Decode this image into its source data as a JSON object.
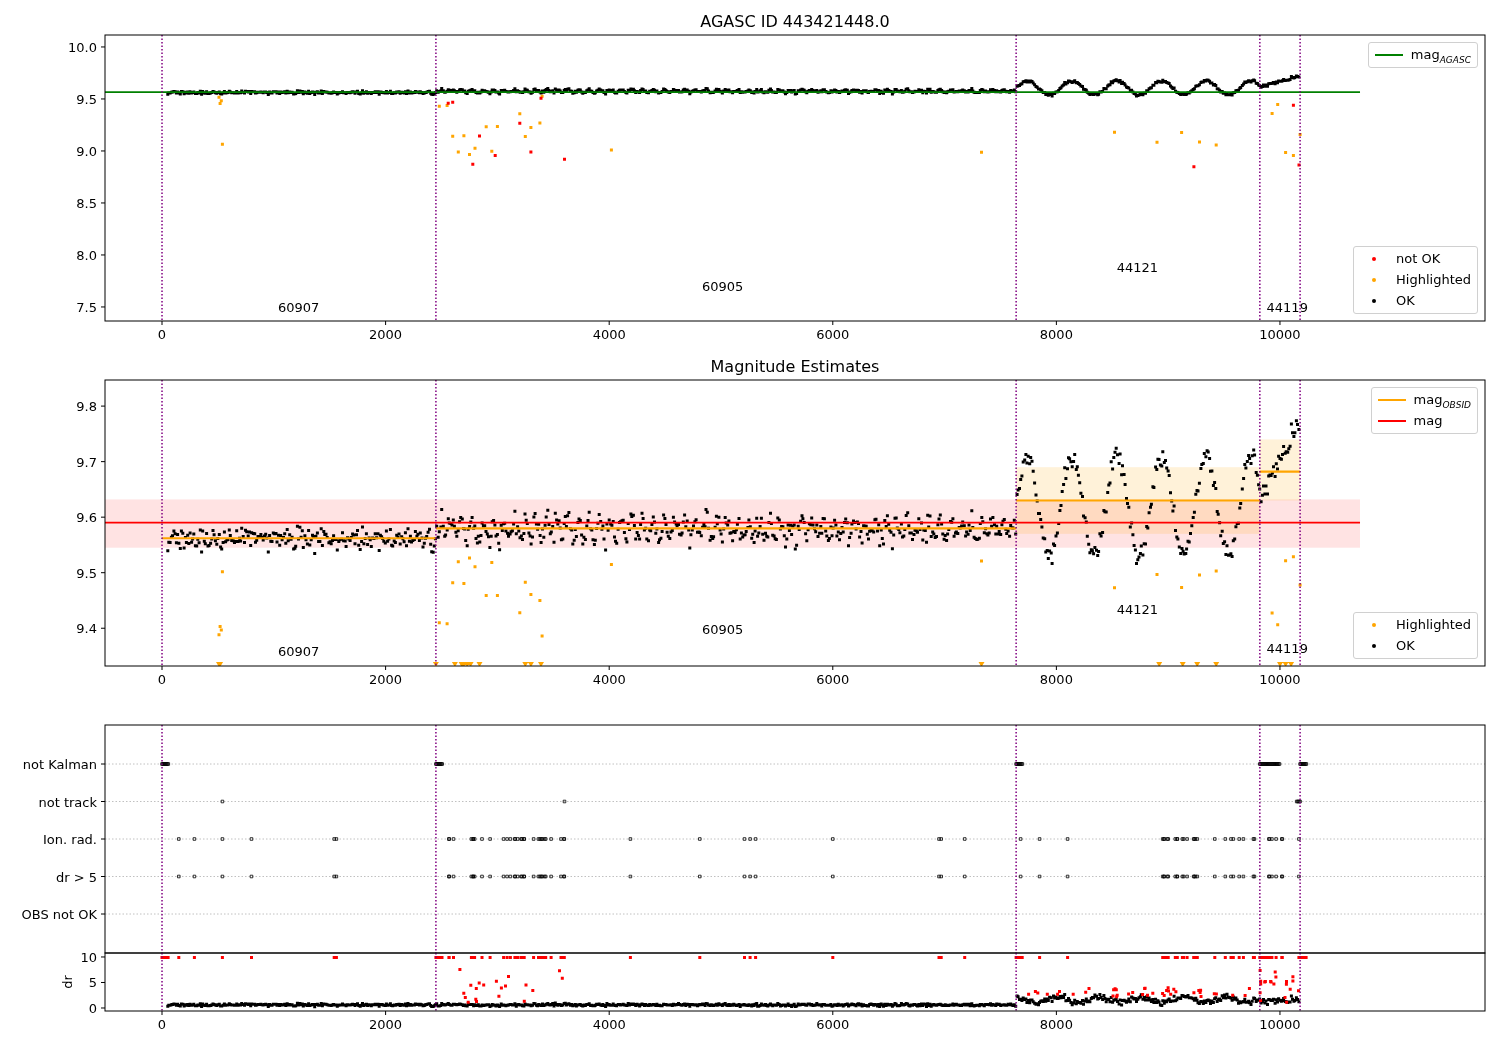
{
  "panels": [
    {
      "kind": "agasc",
      "title": "AGASC ID 443421448.0",
      "y_tick_labels": [
        "10.0",
        "9.5",
        "9.0",
        "8.5",
        "8.0",
        "7.5"
      ],
      "x_tick_labels": [
        "0",
        "2000",
        "4000",
        "6000",
        "8000",
        "10000"
      ],
      "obsid_labels": [
        "60907",
        "60905",
        "44121",
        "44119"
      ],
      "legends": [
        [
          {
            "label": "mag$_{AGASC}$",
            "color": "#008000"
          }
        ],
        [
          {
            "label": "not OK",
            "color": "#ff0000"
          },
          {
            "label": "Highlighted",
            "color": "#ffa500"
          },
          {
            "label": "OK",
            "color": "#000000"
          }
        ]
      ]
    },
    {
      "kind": "estimates",
      "title": "Magnitude Estimates",
      "y_tick_labels": [
        "9.8",
        "9.7",
        "9.6",
        "9.5",
        "9.4"
      ],
      "x_tick_labels": [
        "0",
        "2000",
        "4000",
        "6000",
        "8000",
        "10000"
      ],
      "obsid_labels": [
        "60907",
        "60905",
        "44121",
        "44119"
      ],
      "legends": [
        [
          {
            "label": "mag$_{OBSID}$",
            "color": "#ffa500"
          },
          {
            "label": "mag",
            "color": "#ff0000"
          }
        ],
        [
          {
            "label": "Highlighted",
            "color": "#ffa500"
          },
          {
            "label": "OK",
            "color": "#000000"
          }
        ]
      ]
    },
    {
      "kind": "flags",
      "category_labels": [
        "not Kalman",
        "not track",
        "Ion. rad.",
        "dr > 5",
        "OBS not OK"
      ]
    },
    {
      "kind": "dr",
      "y_label": "dr",
      "y_tick_labels": [
        "10",
        "5",
        "0"
      ],
      "x_tick_labels": [
        "0",
        "2000",
        "4000",
        "6000",
        "8000",
        "10000"
      ]
    }
  ]
}
